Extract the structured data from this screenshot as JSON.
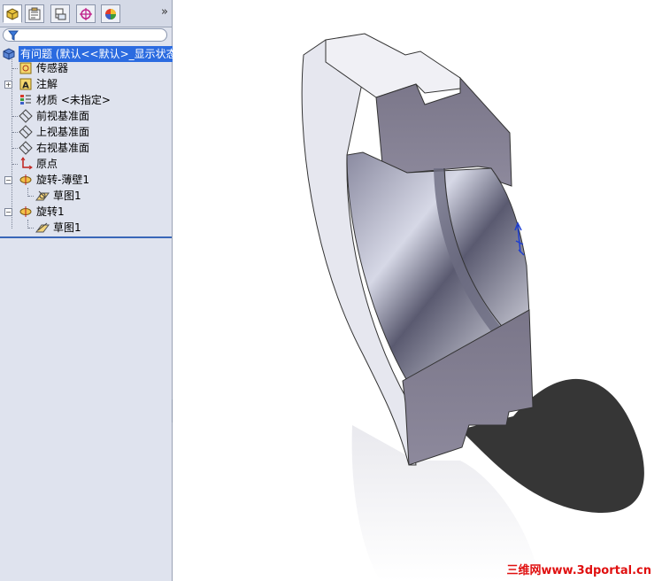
{
  "panel_tabs": [
    {
      "name": "feature-manager",
      "icon": "feature-manager-icon",
      "active": true
    },
    {
      "name": "property-manager",
      "icon": "property-manager-icon",
      "active": false
    },
    {
      "name": "configuration-manager",
      "icon": "configuration-manager-icon",
      "active": false
    },
    {
      "name": "dimxpert-manager",
      "icon": "dimxpert-icon",
      "active": false
    },
    {
      "name": "display-manager",
      "icon": "display-manager-icon",
      "active": false
    }
  ],
  "tab_more_label": "»",
  "filter": {
    "placeholder": "",
    "icon": "filter-icon"
  },
  "tree": {
    "root_label": "有问题 (默认<<默认>_显示状态",
    "items": [
      {
        "label": "传感器",
        "icon": "sensor-icon"
      },
      {
        "label": "注解",
        "icon": "annotation-icon"
      },
      {
        "label": "材质 <未指定>",
        "icon": "material-icon"
      },
      {
        "label": "前视基准面",
        "icon": "plane-icon"
      },
      {
        "label": "上视基准面",
        "icon": "plane-icon"
      },
      {
        "label": "右视基准面",
        "icon": "plane-icon"
      },
      {
        "label": "原点",
        "icon": "origin-icon"
      },
      {
        "label": "旋转-薄壁1",
        "icon": "revolve-thin-icon"
      },
      {
        "label": "草图1",
        "icon": "sketch-icon"
      },
      {
        "label": "旋转1",
        "icon": "revolve-icon"
      },
      {
        "label": "草图1",
        "icon": "sketch-icon"
      }
    ]
  },
  "viewport": {
    "model": "revolved-ring-section-view",
    "triad": "origin-triad-icon"
  },
  "watermark": "三维网www.3dportal.cn"
}
